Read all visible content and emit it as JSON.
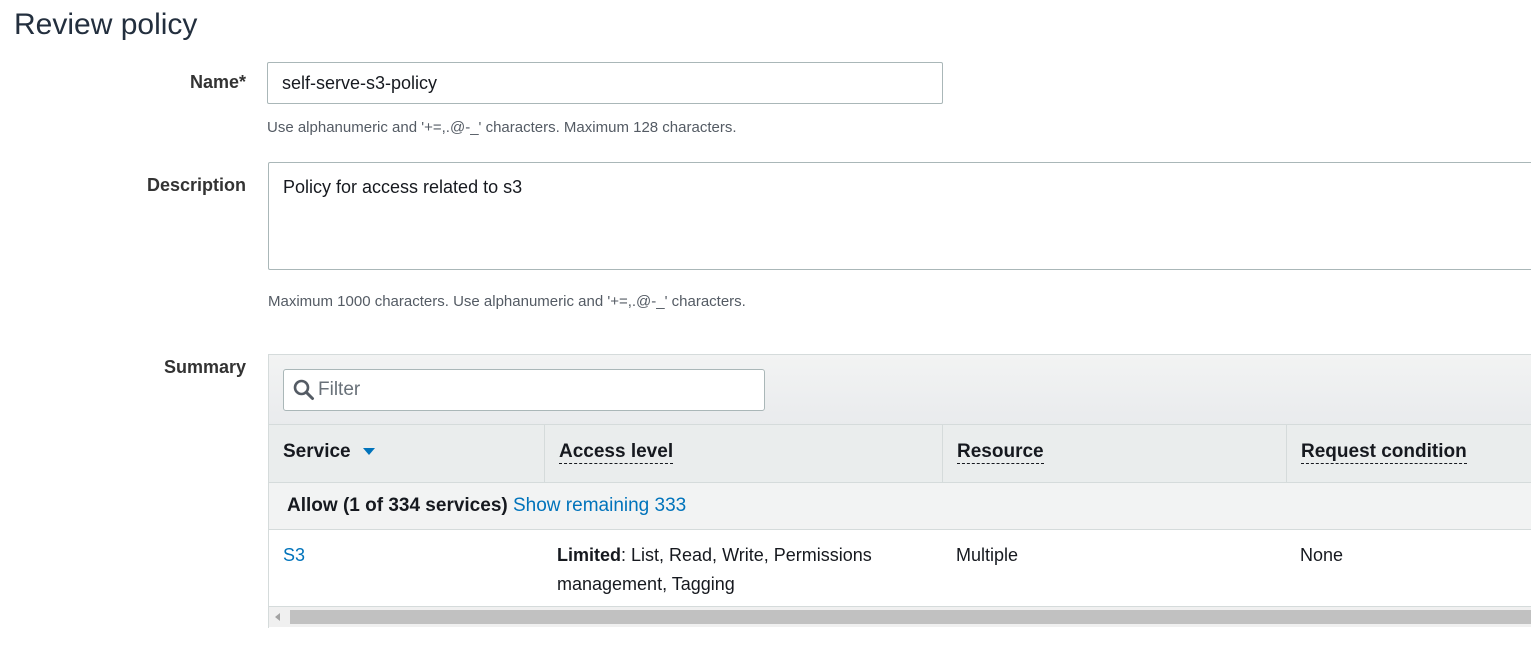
{
  "page": {
    "title": "Review policy"
  },
  "name_field": {
    "label": "Name*",
    "value": "self-serve-s3-policy",
    "hint": "Use alphanumeric and '+=,.@-_' characters. Maximum 128 characters."
  },
  "description_field": {
    "label": "Description",
    "value": "Policy for access related to s3",
    "hint": "Maximum 1000 characters. Use alphanumeric and '+=,.@-_' characters."
  },
  "summary": {
    "label": "Summary",
    "filter_placeholder": "Filter",
    "columns": [
      "Service",
      "Access level",
      "Resource",
      "Request condition"
    ],
    "group": {
      "label": "Allow (1 of 334 services)",
      "link": "Show remaining 333"
    },
    "rows": [
      {
        "service": "S3",
        "access_level_prefix": "Limited",
        "access_level_rest": ": List, Read, Write, Permissions",
        "access_level_line2": "management, Tagging",
        "resource": "Multiple",
        "request_condition": "None"
      }
    ]
  },
  "colors": {
    "link": "#0073bb",
    "header_bg": "#eaeded",
    "border": "#aab7b8"
  },
  "icons": {
    "filter": "search-icon",
    "sort": "caret-down-icon"
  }
}
